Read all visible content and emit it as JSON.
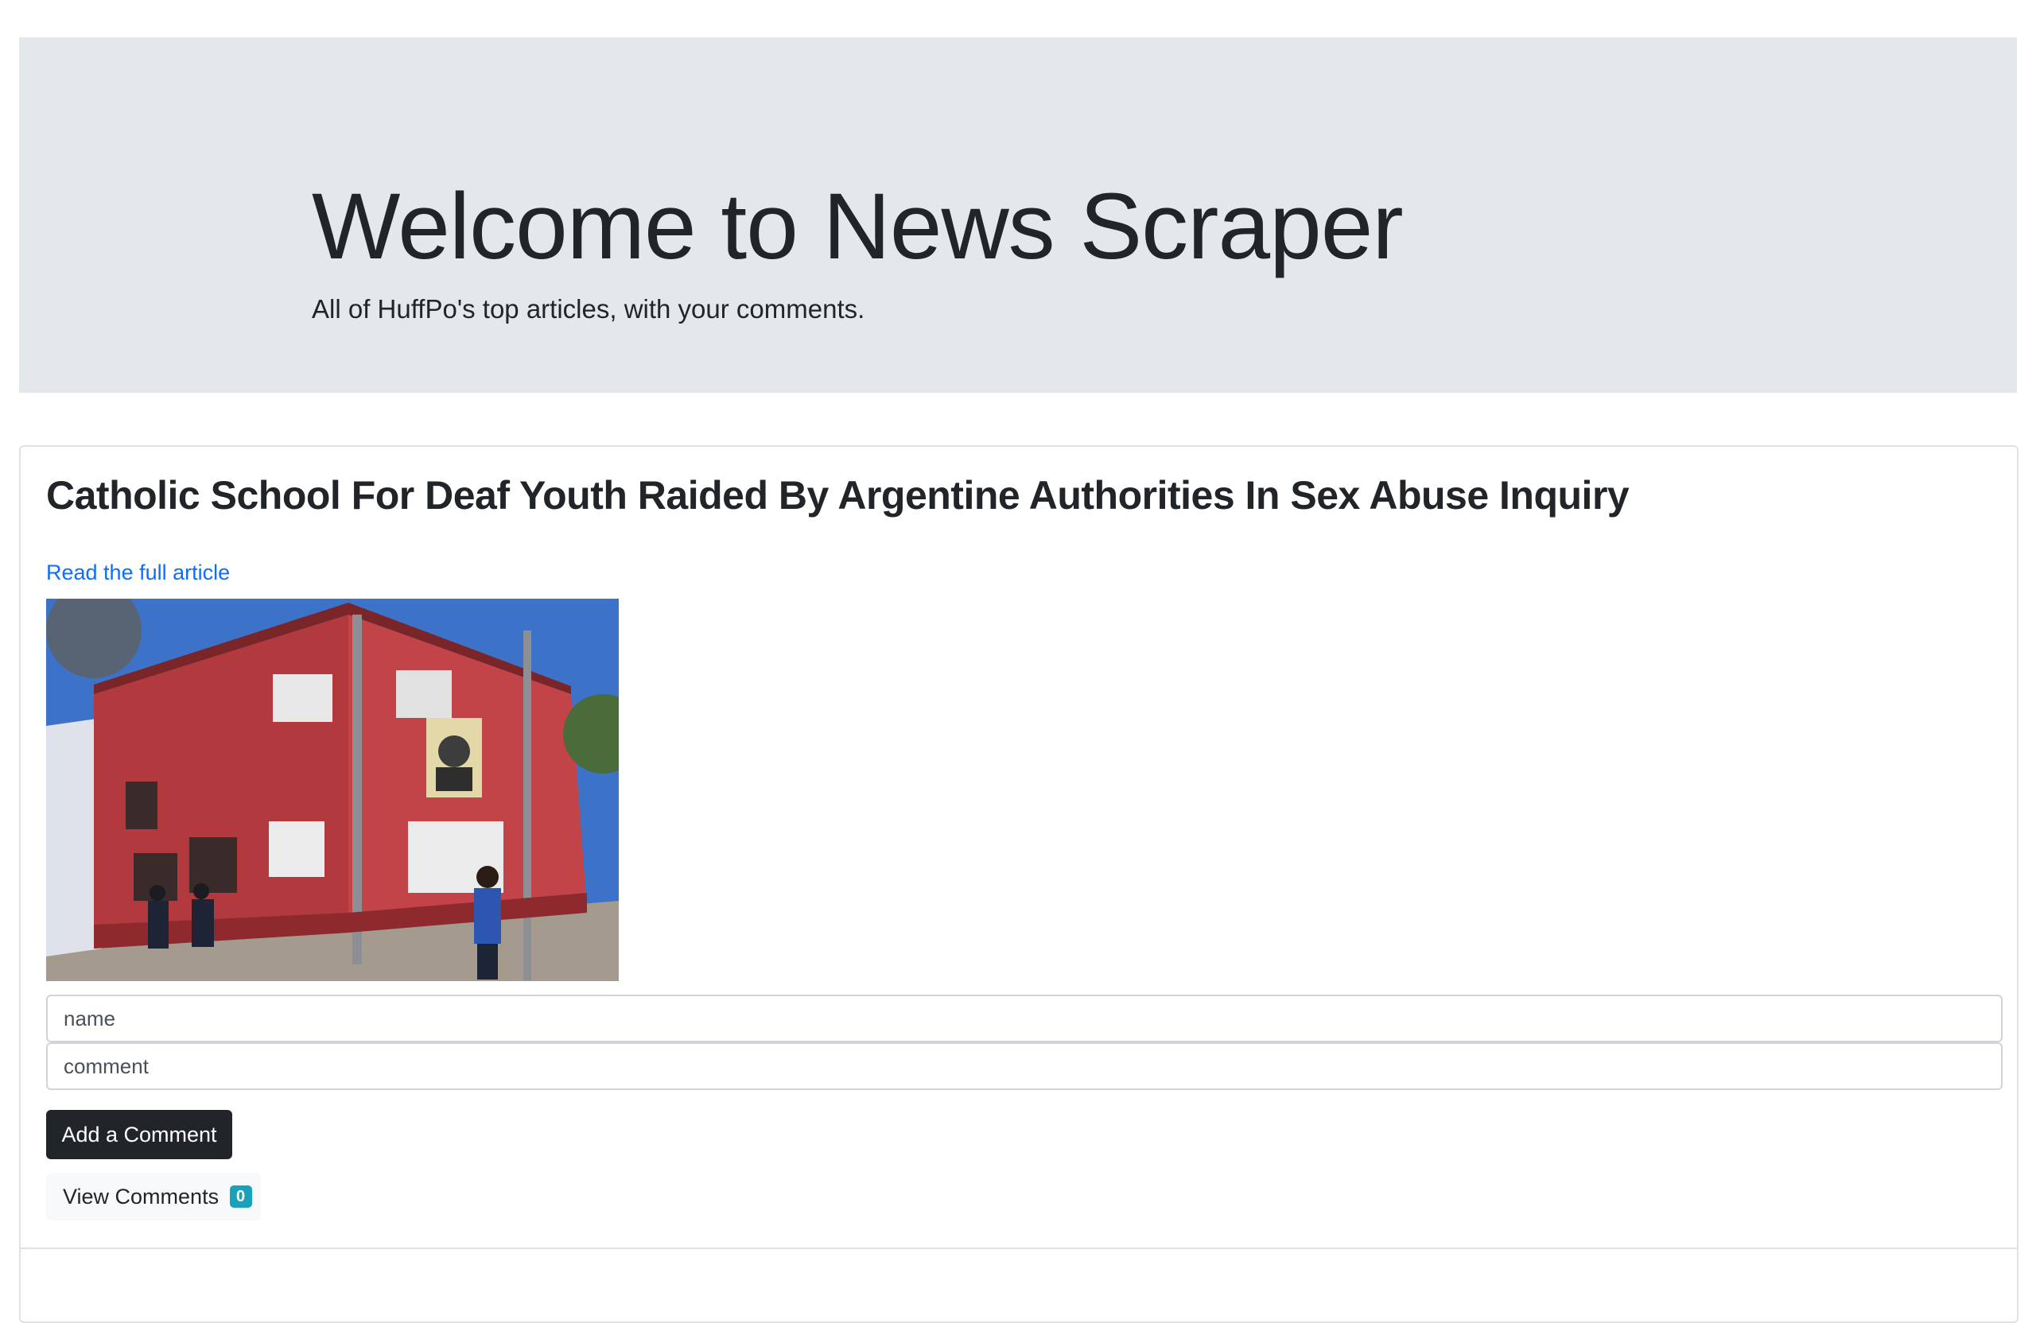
{
  "jumbotron": {
    "title": "Welcome to News Scraper",
    "lead": "All of HuffPo's top articles, with your comments."
  },
  "article": {
    "title": "Catholic School For Deaf Youth Raided By Argentine Authorities In Sex Abuse Inquiry",
    "link_label": "Read the full article",
    "image_icon": "article-photo",
    "name_placeholder": "name",
    "comment_placeholder": "comment",
    "add_comment_label": "Add a Comment",
    "view_comments_label": "View Comments",
    "comment_count": "0"
  },
  "colors": {
    "jumbotron_bg": "#e4e7eb",
    "link": "#0d6efd",
    "dark_button": "#212529",
    "light_button": "#f8f9fa",
    "badge": "#17a2b8"
  }
}
